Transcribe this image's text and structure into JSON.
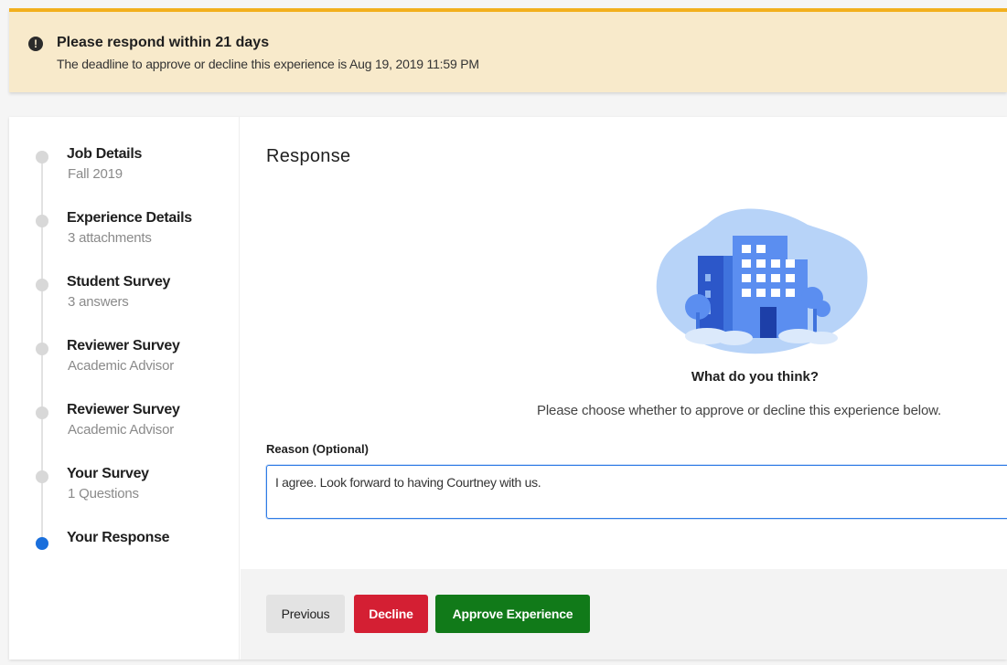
{
  "alert": {
    "icon": "exclamation-icon",
    "title": "Please respond within 21 days",
    "message": "The deadline to approve or decline this experience is Aug 19, 2019 11:59 PM"
  },
  "steps": [
    {
      "title": "Job Details",
      "subtitle": "Fall 2019",
      "active": false
    },
    {
      "title": "Experience Details",
      "subtitle": "3 attachments",
      "active": false
    },
    {
      "title": "Student Survey",
      "subtitle": "3 answers",
      "active": false
    },
    {
      "title": "Reviewer Survey",
      "subtitle": "Academic Advisor",
      "active": false
    },
    {
      "title": "Reviewer Survey",
      "subtitle": "Academic Advisor",
      "active": false
    },
    {
      "title": "Your Survey",
      "subtitle": "1 Questions",
      "active": false
    },
    {
      "title": "Your Response",
      "subtitle": "",
      "active": true
    }
  ],
  "main": {
    "heading": "Response",
    "illustration": "office-building-illustration",
    "question": "What do you think?",
    "instruction": "Please choose whether to approve or decline this experience below.",
    "reason_label": "Reason (Optional)",
    "reason_value": "I agree. Look forward to having Courtney with us."
  },
  "buttons": {
    "previous": "Previous",
    "decline": "Decline",
    "approve": "Approve Experience"
  },
  "colors": {
    "alert_bg": "#f8eacb",
    "alert_border": "#f2b01e",
    "active_step": "#1a6fdc",
    "decline": "#d41f33",
    "approve": "#117a19",
    "focus": "#2f7be5"
  }
}
